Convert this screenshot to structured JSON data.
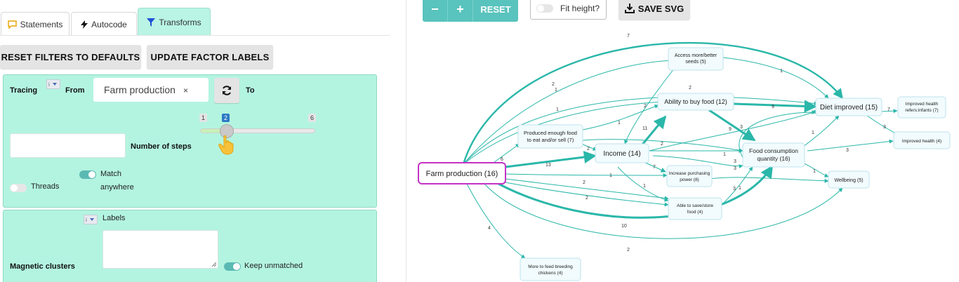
{
  "tabs": {
    "statements": "Statements",
    "autocode": "Autocode",
    "transforms": "Transforms"
  },
  "buttons": {
    "reset_filters": "RESET FILTERS TO DEFAULTS",
    "update_factor_labels": "UPDATE FACTOR LABELS"
  },
  "tracing": {
    "label": "Tracing",
    "from_label": "From",
    "from_chip": "Farm production",
    "chip_remove": "×",
    "to_label": "To",
    "steps_label": "Number of steps",
    "steps_min": "1",
    "steps_value": "2",
    "steps_max": "6",
    "threads_label": "Threads",
    "match_label_1": "Match",
    "match_label_2": "anywhere"
  },
  "clusters": {
    "labels_label": "Labels",
    "magnetic_label": "Magnetic clusters",
    "keep_unmatched_label": "Keep unmatched"
  },
  "toolbar": {
    "zoom_out": "−",
    "zoom_in": "+",
    "reset": "RESET",
    "fit_height": "Fit height?",
    "save_svg": "SAVE SVG"
  },
  "colors": {
    "mint": "#b3f4e0",
    "teal": "#2ab7a9",
    "magenta": "#c531c5",
    "accent_blue": "#2b78c4"
  },
  "graph": {
    "nodes": {
      "farm": "Farm production (16)",
      "enough_food_1": "Produced enough food",
      "enough_food_2": "to eat and/or sell (7)",
      "income": "Income (14)",
      "seeds_1": "Access more/better",
      "seeds_2": "seeds (5)",
      "buy_food": "Ability to buy food (12)",
      "diet": "Diet improved (15)",
      "health_inf_1": "Improved health",
      "health_inf_2": "refers:infants (7)",
      "health": "Improved health (4)",
      "fcq_1": "Food consumption",
      "fcq_2": "quantity (16)",
      "purchasing_1": "Increase purchasing",
      "purchasing_2": "power (8)",
      "save_food_1": "Able to save/store",
      "save_food_2": "food (4)",
      "wellbeing": "Wellbeing (5)",
      "chickens_1": "More to feed breeding",
      "chickens_2": "chickens (4)"
    },
    "edge_labels": [
      "7",
      "2",
      "1",
      "1",
      "2",
      "9",
      "1",
      "7",
      "3",
      "6",
      "13",
      "2",
      "11",
      "1",
      "7",
      "2",
      "9",
      "3",
      "3",
      "1",
      "3",
      "1",
      "1",
      "3",
      "2",
      "2",
      "2",
      "3",
      "1",
      "10",
      "4",
      "2",
      "1",
      "1"
    ]
  }
}
